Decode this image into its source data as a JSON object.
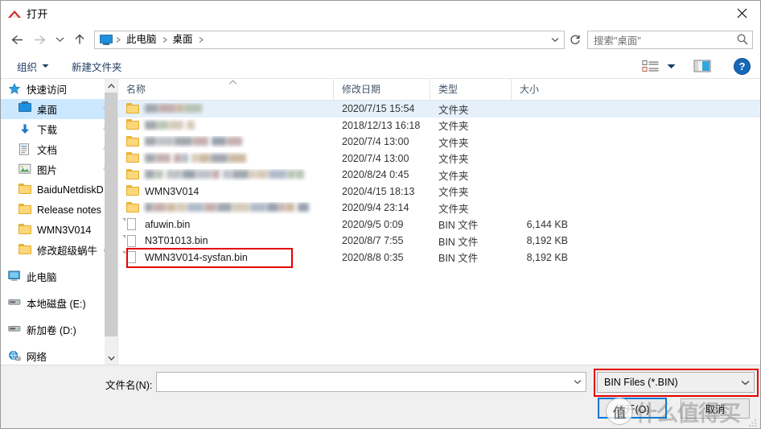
{
  "window": {
    "title": "打开",
    "title_icon": "red-triangle-app-icon",
    "close_icon": "close-icon"
  },
  "nav": {
    "back_icon": "arrow-left-icon",
    "forward_icon": "arrow-right-icon",
    "recent_icon": "chevron-down-icon",
    "up_icon": "arrow-up-icon",
    "refresh_icon": "refresh-icon",
    "address_dropdown_icon": "chevron-down-icon",
    "breadcrumbs": [
      "此电脑",
      "桌面"
    ],
    "breadcrumb_root_icon": "this-pc-icon"
  },
  "search": {
    "placeholder": "搜索\"桌面\"",
    "icon": "search-icon"
  },
  "toolbar": {
    "organize_label": "组织",
    "organize_caret_icon": "caret-down-icon",
    "new_folder_label": "新建文件夹",
    "view_icon": "view-list-icon",
    "view_caret_icon": "caret-down-icon",
    "preview_pane_icon": "preview-pane-icon",
    "help_label": "?",
    "help_icon": "help-icon"
  },
  "sidebar": {
    "items": [
      {
        "label": "快速访问",
        "icon": "star-pin-icon",
        "root": true,
        "selected": false,
        "pinned": false
      },
      {
        "label": "桌面",
        "icon": "desktop-monitor-icon",
        "root": false,
        "selected": true,
        "pinned": true
      },
      {
        "label": "下载",
        "icon": "download-arrow-icon",
        "root": false,
        "selected": false,
        "pinned": true
      },
      {
        "label": "文档",
        "icon": "documents-icon",
        "root": false,
        "selected": false,
        "pinned": true
      },
      {
        "label": "图片",
        "icon": "pictures-icon",
        "root": false,
        "selected": false,
        "pinned": true
      },
      {
        "label": "BaiduNetdiskD",
        "icon": "folder-icon",
        "root": false,
        "selected": false,
        "pinned": false
      },
      {
        "label": "Release notes",
        "icon": "folder-icon",
        "root": false,
        "selected": false,
        "pinned": false
      },
      {
        "label": "WMN3V014",
        "icon": "folder-icon",
        "root": false,
        "selected": false,
        "pinned": false
      },
      {
        "label": "修改超级蜗牛（",
        "icon": "folder-icon",
        "root": false,
        "selected": false,
        "pinned": false
      },
      {
        "label": "此电脑",
        "icon": "this-pc-icon",
        "root": true,
        "selected": false,
        "pinned": false
      },
      {
        "label": "本地磁盘 (E:)",
        "icon": "disk-drive-icon",
        "root": true,
        "selected": false,
        "pinned": false
      },
      {
        "label": "新加卷 (D:)",
        "icon": "disk-drive-icon",
        "root": true,
        "selected": false,
        "pinned": false
      },
      {
        "label": "网络",
        "icon": "network-icon",
        "root": true,
        "selected": false,
        "pinned": false
      }
    ],
    "scroll_up_icon": "chevron-up-icon",
    "scroll_down_icon": "chevron-down-icon"
  },
  "filelist": {
    "columns": [
      "名称",
      "修改日期",
      "类型",
      "大小"
    ],
    "sort_caret_icon": "sort-ascending-icon",
    "rows": [
      {
        "name": "",
        "censored": true,
        "censor_width": 62,
        "date": "2020/7/15 15:54",
        "type": "文件夹",
        "size": "",
        "icon": "folder-icon",
        "selected": true,
        "highlighted": false
      },
      {
        "name": "",
        "censored": true,
        "censor_width": 62,
        "date": "2018/12/13 16:18",
        "type": "文件夹",
        "size": "",
        "icon": "folder-icon",
        "selected": false,
        "highlighted": false
      },
      {
        "name": "",
        "censored": true,
        "censor_width": 112,
        "date": "2020/7/4 13:00",
        "type": "文件夹",
        "size": "",
        "icon": "folder-icon",
        "selected": false,
        "highlighted": false
      },
      {
        "name": "",
        "censored": true,
        "censor_width": 105,
        "date": "2020/7/4 13:00",
        "type": "文件夹",
        "size": "",
        "icon": "folder-icon",
        "selected": false,
        "highlighted": false
      },
      {
        "name": "",
        "censored": true,
        "censor_width": 192,
        "date": "2020/8/24 0:45",
        "type": "文件夹",
        "size": "",
        "icon": "folder-icon",
        "selected": false,
        "highlighted": false
      },
      {
        "name": "WMN3V014",
        "censored": false,
        "censor_width": 0,
        "date": "2020/4/15 18:13",
        "type": "文件夹",
        "size": "",
        "icon": "folder-icon",
        "selected": false,
        "highlighted": false
      },
      {
        "name": "",
        "censored": true,
        "censor_width": 205,
        "date": "2020/9/4 23:14",
        "type": "文件夹",
        "size": "",
        "icon": "folder-icon",
        "selected": false,
        "highlighted": false
      },
      {
        "name": "afuwin.bin",
        "censored": false,
        "censor_width": 0,
        "date": "2020/9/5 0:09",
        "type": "BIN 文件",
        "size": "6,144 KB",
        "icon": "file-icon",
        "selected": false,
        "highlighted": false
      },
      {
        "name": "N3T01013.bin",
        "censored": false,
        "censor_width": 0,
        "date": "2020/8/7 7:55",
        "type": "BIN 文件",
        "size": "8,192 KB",
        "icon": "file-icon",
        "selected": false,
        "highlighted": false
      },
      {
        "name": "WMN3V014-sysfan.bin",
        "censored": false,
        "censor_width": 0,
        "date": "2020/8/8 0:35",
        "type": "BIN 文件",
        "size": "8,192 KB",
        "icon": "file-icon",
        "selected": false,
        "highlighted": true
      }
    ]
  },
  "bottom": {
    "filename_label": "文件名(N):",
    "filename_value": "",
    "filename_caret_icon": "chevron-down-icon",
    "filter_value": "BIN Files (*.BIN)",
    "filter_caret_icon": "chevron-down-icon",
    "open_label": "打开(O)",
    "cancel_label": "取消",
    "resize_grip_icon": "resize-grip-icon"
  },
  "watermark": {
    "logo_char": "值",
    "text": "什么值得买"
  },
  "colors": {
    "accent": "#0078d7",
    "selection": "#cce8ff",
    "row_highlight": "#e5f0fb",
    "annotation_red": "#e60000",
    "header_text": "#44546a",
    "toolbar_text": "#1e3a5f"
  }
}
